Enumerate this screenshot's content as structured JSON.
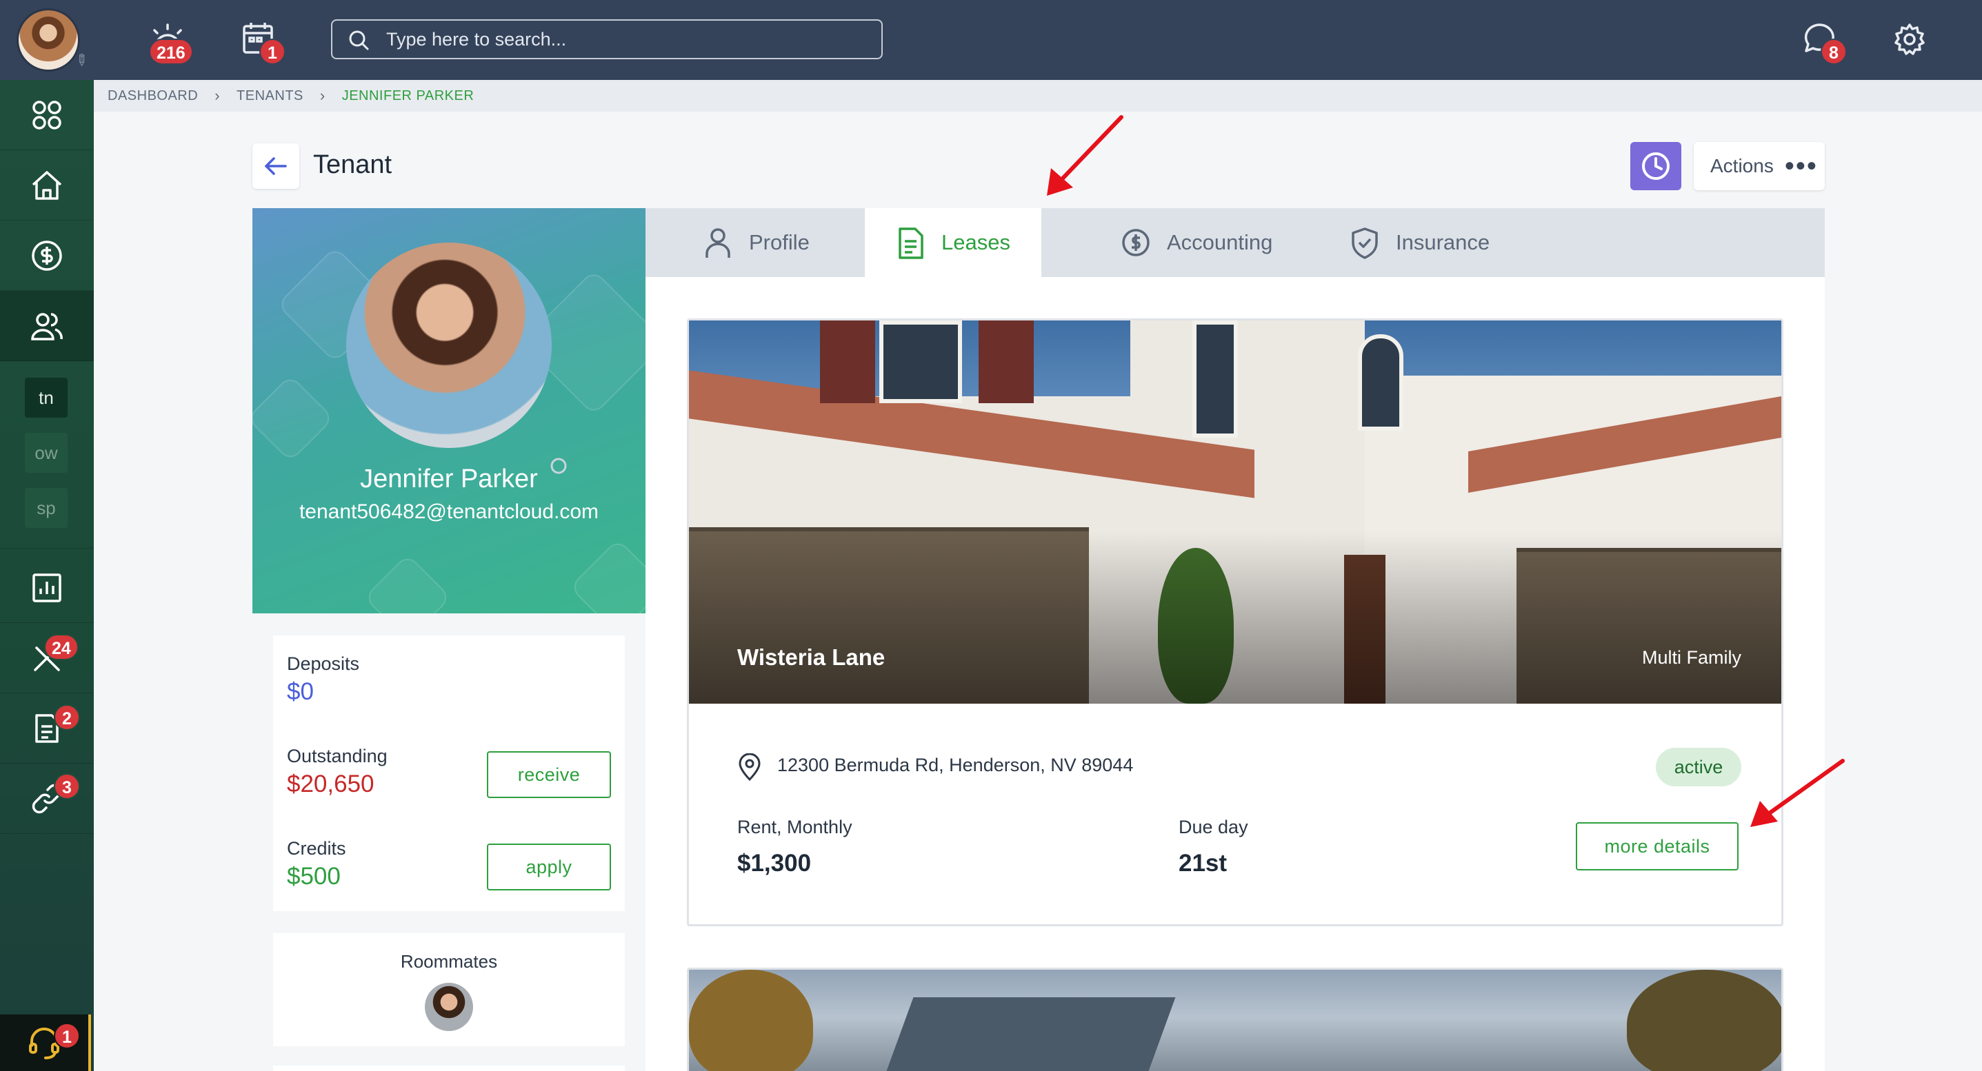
{
  "topbar": {
    "notifications_badge": "216",
    "calendar_badge": "1",
    "search_placeholder": "Type here to search...",
    "chat_badge": "8"
  },
  "sidebar": {
    "mini_items": [
      "tn",
      "ow",
      "sp"
    ],
    "maintenance_badge": "24",
    "applications_badge": "2",
    "listings_badge": "3",
    "support_badge": "1"
  },
  "breadcrumb": [
    "DASHBOARD",
    "TENANTS",
    "JENNIFER PARKER"
  ],
  "header": {
    "title": "Tenant",
    "actions_label": "Actions"
  },
  "profile": {
    "name": "Jennifer Parker",
    "email": "tenant506482@tenantcloud.com"
  },
  "balances": {
    "deposits_label": "Deposits",
    "deposits_value": "$0",
    "outstanding_label": "Outstanding",
    "outstanding_value": "$20,650",
    "receive_label": "receive",
    "credits_label": "Credits",
    "credits_value": "$500",
    "apply_label": "apply"
  },
  "roommates": {
    "title": "Roommates"
  },
  "tabs": [
    {
      "label": "Profile",
      "icon": "user-icon"
    },
    {
      "label": "Leases",
      "icon": "document-icon"
    },
    {
      "label": "Accounting",
      "icon": "dollar-circle-icon"
    },
    {
      "label": "Insurance",
      "icon": "shield-check-icon"
    }
  ],
  "lease": {
    "property_name": "Wisteria Lane",
    "property_type": "Multi Family",
    "address": "12300 Bermuda Rd, Henderson, NV 89044",
    "status": "active",
    "rent_label": "Rent, Monthly",
    "rent_value": "$1,300",
    "due_label": "Due day",
    "due_value": "21st",
    "more_details_label": "more details"
  },
  "colors": {
    "topbar": "#34435a",
    "sidebar": "#1f4e3c",
    "accent_green": "#2d9f3e",
    "outstanding_red": "#c62828",
    "deposits_blue": "#4a5fd8",
    "history_purple": "#7b6ad9",
    "annotation_red": "#e5121b"
  }
}
